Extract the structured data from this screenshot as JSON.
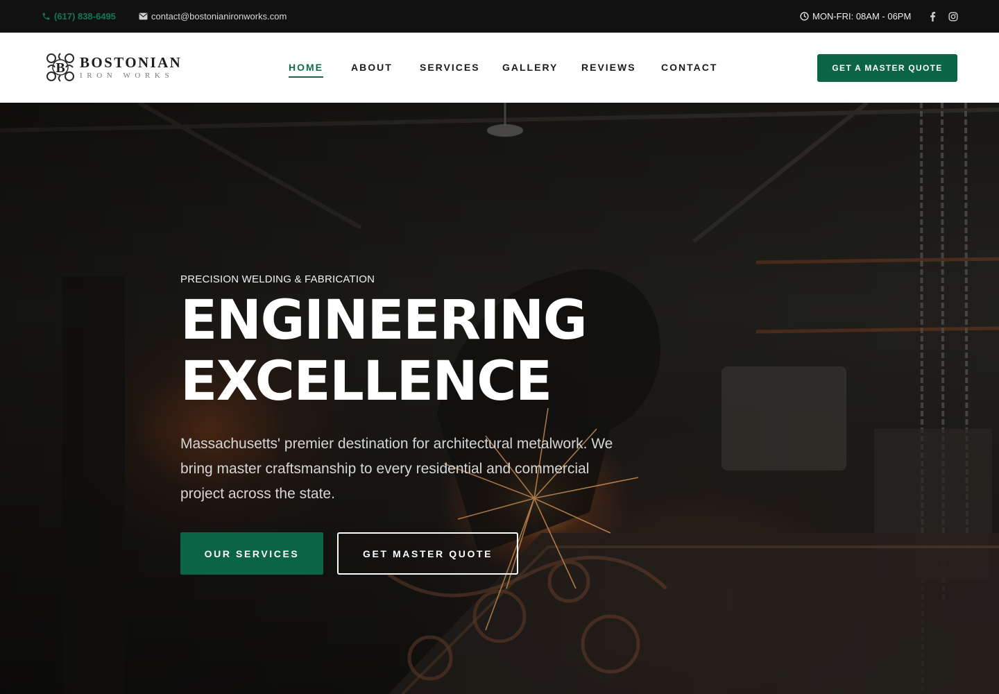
{
  "topbar": {
    "phone": "(617) 838-6495",
    "email": "contact@bostonianironworks.com",
    "hours": "MON-FRI: 08AM - 06PM",
    "social": [
      "facebook-icon",
      "instagram-icon"
    ]
  },
  "brand": {
    "name": "BOSTONIAN",
    "tagline": "IRON WORKS",
    "monogram": "B"
  },
  "nav": {
    "items": [
      {
        "label": "HOME",
        "active": true
      },
      {
        "label": "ABOUT",
        "active": false
      },
      {
        "label": "SERVICES",
        "active": false
      },
      {
        "label": "GALLERY",
        "active": false
      },
      {
        "label": "REVIEWS",
        "active": false
      },
      {
        "label": "CONTACT",
        "active": false
      }
    ],
    "cta": "GET A MASTER QUOTE"
  },
  "hero": {
    "eyebrow": "PRECISION WELDING & FABRICATION",
    "title_line1": "ENGINEERING",
    "title_line2": "EXCELLENCE",
    "description": "Massachusetts' premier destination for architectural metalwork. We bring master craftsmanship to every residential and commercial project across the state.",
    "primary_button": "OUR SERVICES",
    "secondary_button": "GET MASTER QUOTE"
  },
  "colors": {
    "accent": "#0c6447",
    "topbar_bg": "#111111",
    "header_bg": "#ffffff",
    "phone": "#0f7a52"
  }
}
